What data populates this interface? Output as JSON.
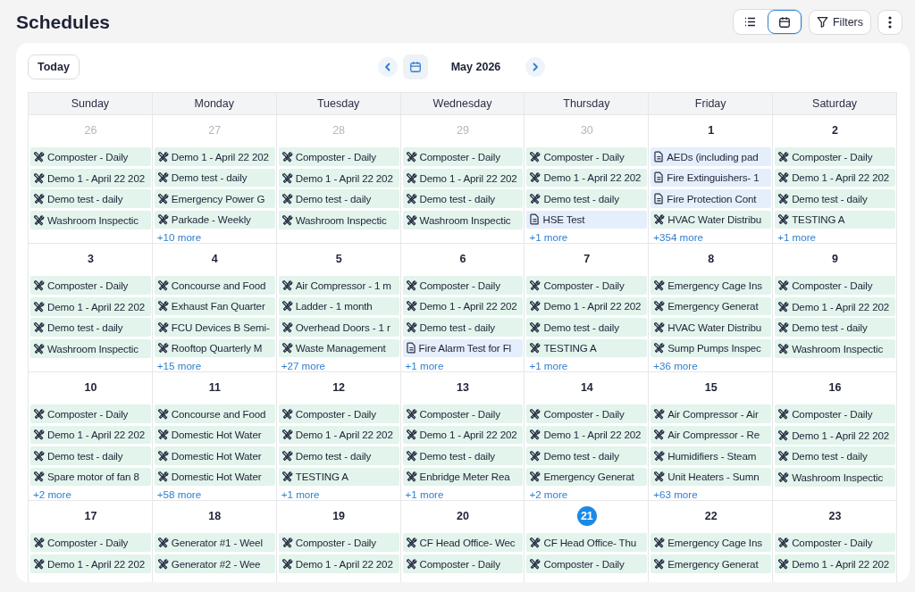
{
  "page": {
    "title": "Schedules"
  },
  "toolbar": {
    "view_toggle": [
      {
        "kind": "list",
        "selected": false
      },
      {
        "kind": "calendar",
        "selected": true
      }
    ],
    "filters_label": "Filters"
  },
  "navigation": {
    "today_label": "Today",
    "month": "May 2026"
  },
  "calendar": {
    "weekdays": [
      "Sunday",
      "Monday",
      "Tuesday",
      "Wednesday",
      "Thursday",
      "Friday",
      "Saturday"
    ],
    "weeks": [
      {
        "days": [
          {
            "date": "26",
            "outside_month": true,
            "today": false,
            "events": [
              {
                "kind": "task",
                "title": "Composter - Daily"
              },
              {
                "kind": "task",
                "title": "Demo 1 - April 22 202"
              },
              {
                "kind": "task",
                "title": "Demo test - daily"
              },
              {
                "kind": "task",
                "title": "Washroom Inspectic"
              }
            ]
          },
          {
            "date": "27",
            "outside_month": true,
            "today": false,
            "events": [
              {
                "kind": "task",
                "title": "Demo 1 - April 22 202"
              },
              {
                "kind": "task",
                "title": "Demo test - daily"
              },
              {
                "kind": "task",
                "title": "Emergency Power G"
              },
              {
                "kind": "task",
                "title": "Parkade - Weekly"
              }
            ],
            "more": "+10 more"
          },
          {
            "date": "28",
            "outside_month": true,
            "today": false,
            "events": [
              {
                "kind": "task",
                "title": "Composter - Daily"
              },
              {
                "kind": "task",
                "title": "Demo 1 - April 22 202"
              },
              {
                "kind": "task",
                "title": "Demo test - daily"
              },
              {
                "kind": "task",
                "title": "Washroom Inspectic"
              }
            ]
          },
          {
            "date": "29",
            "outside_month": true,
            "today": false,
            "events": [
              {
                "kind": "task",
                "title": "Composter - Daily"
              },
              {
                "kind": "task",
                "title": "Demo 1 - April 22 202"
              },
              {
                "kind": "task",
                "title": "Demo test - daily"
              },
              {
                "kind": "task",
                "title": "Washroom Inspectic"
              }
            ]
          },
          {
            "date": "30",
            "outside_month": true,
            "today": false,
            "events": [
              {
                "kind": "task",
                "title": "Composter - Daily"
              },
              {
                "kind": "task",
                "title": "Demo 1 - April 22 202"
              },
              {
                "kind": "task",
                "title": "Demo test - daily"
              },
              {
                "kind": "document",
                "title": "HSE Test"
              }
            ],
            "more": "+1 more"
          },
          {
            "date": "1",
            "outside_month": false,
            "today": false,
            "events": [
              {
                "kind": "document",
                "title": "AEDs (including pad"
              },
              {
                "kind": "document",
                "title": "Fire Extinguishers- 1"
              },
              {
                "kind": "document",
                "title": "Fire Protection Cont"
              },
              {
                "kind": "task",
                "title": "HVAC Water Distribu"
              }
            ],
            "more": "+354 more"
          },
          {
            "date": "2",
            "outside_month": false,
            "today": false,
            "events": [
              {
                "kind": "task",
                "title": "Composter - Daily"
              },
              {
                "kind": "task",
                "title": "Demo 1 - April 22 202"
              },
              {
                "kind": "task",
                "title": "Demo test - daily"
              },
              {
                "kind": "task",
                "title": "TESTING A"
              }
            ],
            "more": "+1 more"
          }
        ]
      },
      {
        "days": [
          {
            "date": "3",
            "outside_month": false,
            "today": false,
            "events": [
              {
                "kind": "task",
                "title": "Composter - Daily"
              },
              {
                "kind": "task",
                "title": "Demo 1 - April 22 202"
              },
              {
                "kind": "task",
                "title": "Demo test - daily"
              },
              {
                "kind": "task",
                "title": "Washroom Inspectic"
              }
            ]
          },
          {
            "date": "4",
            "outside_month": false,
            "today": false,
            "events": [
              {
                "kind": "task",
                "title": "Concourse and Food"
              },
              {
                "kind": "task",
                "title": "Exhaust Fan Quarter"
              },
              {
                "kind": "task",
                "title": "FCU Devices B Semi-"
              },
              {
                "kind": "task",
                "title": "Rooftop Quarterly M"
              }
            ],
            "more": "+15 more"
          },
          {
            "date": "5",
            "outside_month": false,
            "today": false,
            "events": [
              {
                "kind": "task",
                "title": "Air Compressor - 1 m"
              },
              {
                "kind": "task",
                "title": "Ladder - 1 month"
              },
              {
                "kind": "task",
                "title": "Overhead Doors - 1 r"
              },
              {
                "kind": "task",
                "title": "Waste Management"
              }
            ],
            "more": "+27 more"
          },
          {
            "date": "6",
            "outside_month": false,
            "today": false,
            "events": [
              {
                "kind": "task",
                "title": "Composter - Daily"
              },
              {
                "kind": "task",
                "title": "Demo 1 - April 22 202"
              },
              {
                "kind": "task",
                "title": "Demo test - daily"
              },
              {
                "kind": "document",
                "title": "Fire Alarm Test for Fl"
              }
            ],
            "more": "+1 more"
          },
          {
            "date": "7",
            "outside_month": false,
            "today": false,
            "events": [
              {
                "kind": "task",
                "title": "Composter - Daily"
              },
              {
                "kind": "task",
                "title": "Demo 1 - April 22 202"
              },
              {
                "kind": "task",
                "title": "Demo test - daily"
              },
              {
                "kind": "task",
                "title": "TESTING A"
              }
            ],
            "more": "+1 more"
          },
          {
            "date": "8",
            "outside_month": false,
            "today": false,
            "events": [
              {
                "kind": "task",
                "title": "Emergency Cage Ins"
              },
              {
                "kind": "task",
                "title": "Emergency Generat"
              },
              {
                "kind": "task",
                "title": "HVAC Water Distribu"
              },
              {
                "kind": "task",
                "title": "Sump Pumps Inspec"
              }
            ],
            "more": "+36 more"
          },
          {
            "date": "9",
            "outside_month": false,
            "today": false,
            "events": [
              {
                "kind": "task",
                "title": "Composter - Daily"
              },
              {
                "kind": "task",
                "title": "Demo 1 - April 22 202"
              },
              {
                "kind": "task",
                "title": "Demo test - daily"
              },
              {
                "kind": "task",
                "title": "Washroom Inspectic"
              }
            ]
          }
        ]
      },
      {
        "days": [
          {
            "date": "10",
            "outside_month": false,
            "today": false,
            "events": [
              {
                "kind": "task",
                "title": "Composter - Daily"
              },
              {
                "kind": "task",
                "title": "Demo 1 - April 22 202"
              },
              {
                "kind": "task",
                "title": "Demo test - daily"
              },
              {
                "kind": "task",
                "title": "Spare motor of fan 8"
              }
            ],
            "more": "+2 more"
          },
          {
            "date": "11",
            "outside_month": false,
            "today": false,
            "events": [
              {
                "kind": "task",
                "title": "Concourse and Food"
              },
              {
                "kind": "task",
                "title": "Domestic Hot Water"
              },
              {
                "kind": "task",
                "title": "Domestic Hot Water"
              },
              {
                "kind": "task",
                "title": "Domestic Hot Water"
              }
            ],
            "more": "+58 more"
          },
          {
            "date": "12",
            "outside_month": false,
            "today": false,
            "events": [
              {
                "kind": "task",
                "title": "Composter - Daily"
              },
              {
                "kind": "task",
                "title": "Demo 1 - April 22 202"
              },
              {
                "kind": "task",
                "title": "Demo test - daily"
              },
              {
                "kind": "task",
                "title": "TESTING A"
              }
            ],
            "more": "+1 more"
          },
          {
            "date": "13",
            "outside_month": false,
            "today": false,
            "events": [
              {
                "kind": "task",
                "title": "Composter - Daily"
              },
              {
                "kind": "task",
                "title": "Demo 1 - April 22 202"
              },
              {
                "kind": "task",
                "title": "Demo test - daily"
              },
              {
                "kind": "task",
                "title": "Enbridge Meter Rea"
              }
            ],
            "more": "+1 more"
          },
          {
            "date": "14",
            "outside_month": false,
            "today": false,
            "events": [
              {
                "kind": "task",
                "title": "Composter - Daily"
              },
              {
                "kind": "task",
                "title": "Demo 1 - April 22 202"
              },
              {
                "kind": "task",
                "title": "Demo test - daily"
              },
              {
                "kind": "task",
                "title": "Emergency Generat"
              }
            ],
            "more": "+2 more"
          },
          {
            "date": "15",
            "outside_month": false,
            "today": false,
            "events": [
              {
                "kind": "task",
                "title": "Air Compressor - Air"
              },
              {
                "kind": "task",
                "title": "Air Compressor - Re"
              },
              {
                "kind": "task",
                "title": "Humidifiers - Steam"
              },
              {
                "kind": "task",
                "title": "Unit Heaters - Sumn"
              }
            ],
            "more": "+63 more"
          },
          {
            "date": "16",
            "outside_month": false,
            "today": false,
            "events": [
              {
                "kind": "task",
                "title": "Composter - Daily"
              },
              {
                "kind": "task",
                "title": "Demo 1 - April 22 202"
              },
              {
                "kind": "task",
                "title": "Demo test - daily"
              },
              {
                "kind": "task",
                "title": "Washroom Inspectic"
              }
            ]
          }
        ]
      },
      {
        "days": [
          {
            "date": "17",
            "outside_month": false,
            "today": false,
            "events": [
              {
                "kind": "task",
                "title": "Composter - Daily"
              },
              {
                "kind": "task",
                "title": "Demo 1 - April 22 202"
              }
            ]
          },
          {
            "date": "18",
            "outside_month": false,
            "today": false,
            "events": [
              {
                "kind": "task",
                "title": "Generator #1 - Weel"
              },
              {
                "kind": "task",
                "title": "Generator #2 - Wee"
              }
            ]
          },
          {
            "date": "19",
            "outside_month": false,
            "today": false,
            "events": [
              {
                "kind": "task",
                "title": "Composter - Daily"
              },
              {
                "kind": "task",
                "title": "Demo 1 - April 22 202"
              }
            ]
          },
          {
            "date": "20",
            "outside_month": false,
            "today": false,
            "events": [
              {
                "kind": "task",
                "title": "CF Head Office- Wec"
              },
              {
                "kind": "task",
                "title": "Composter - Daily"
              }
            ]
          },
          {
            "date": "21",
            "outside_month": false,
            "today": true,
            "events": [
              {
                "kind": "task",
                "title": "CF Head Office- Thu"
              },
              {
                "kind": "task",
                "title": "Composter - Daily"
              }
            ]
          },
          {
            "date": "22",
            "outside_month": false,
            "today": false,
            "events": [
              {
                "kind": "task",
                "title": "Emergency Cage Ins"
              },
              {
                "kind": "task",
                "title": "Emergency Generat"
              }
            ]
          },
          {
            "date": "23",
            "outside_month": false,
            "today": false,
            "events": [
              {
                "kind": "task",
                "title": "Composter - Daily"
              },
              {
                "kind": "task",
                "title": "Demo 1 - April 22 202"
              }
            ]
          }
        ]
      }
    ]
  }
}
